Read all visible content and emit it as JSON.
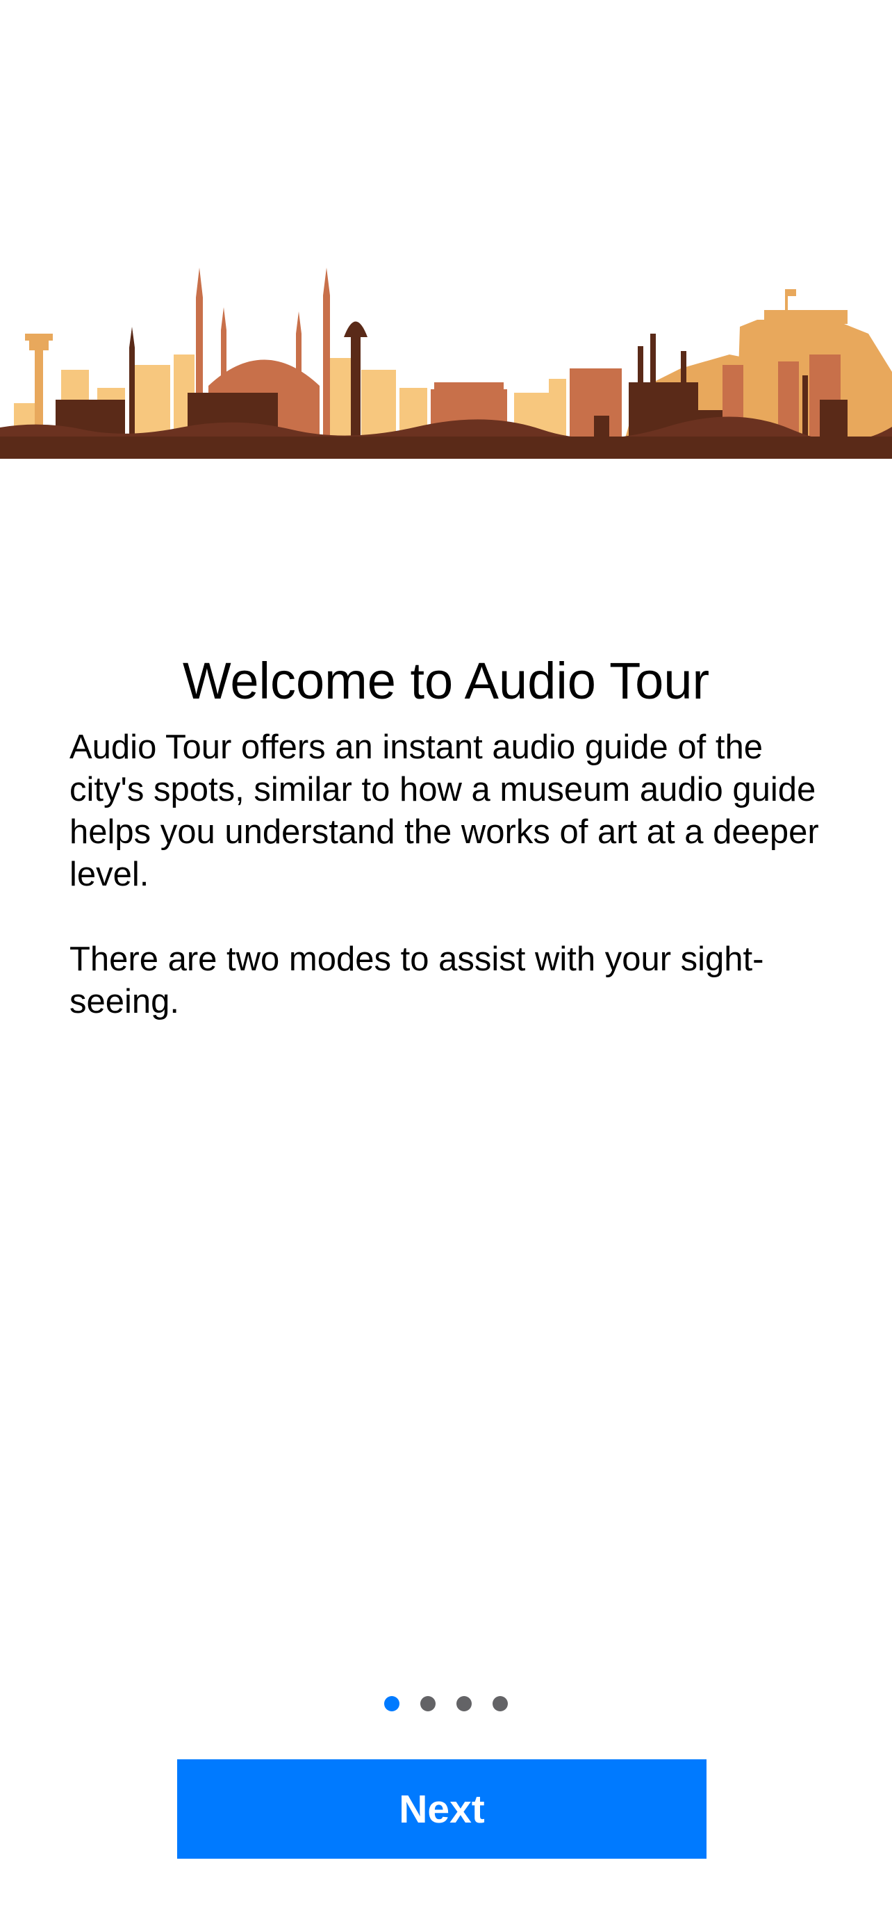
{
  "onboarding": {
    "title": "Welcome to Audio Tour",
    "paragraphs": [
      "Audio Tour offers an instant audio guide of the city's spots, similar to how a museum audio guide helps you understand the works of art at a deeper level.",
      "There are two modes to assist with your sight-seeing."
    ],
    "next_label": "Next"
  },
  "pager": {
    "total_pages": 4,
    "current_page": 1
  },
  "illustration": {
    "icon": "city-skyline-illustration"
  },
  "colors": {
    "accent": "#007aff",
    "inactive_dot": "#636366",
    "skyline_dark": "#5a2a18",
    "skyline_mid": "#c8704a",
    "skyline_light": "#e8a85c",
    "skyline_pale": "#f7c77e"
  }
}
